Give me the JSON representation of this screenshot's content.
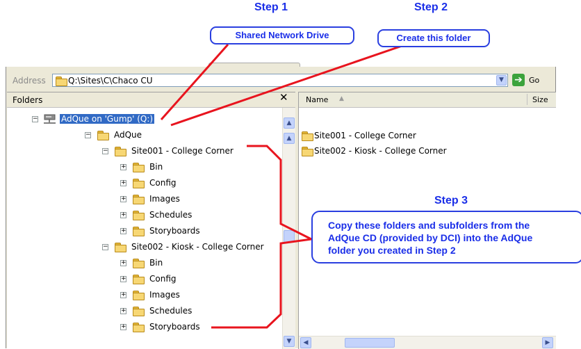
{
  "annotations": {
    "step1": {
      "title": "Step 1",
      "note": "Shared Network Drive"
    },
    "step2": {
      "title": "Step 2",
      "note": "Create this folder"
    },
    "step3": {
      "title": "Step 3",
      "note_lines": [
        "Copy these folders and subfolders from the",
        "AdQue CD (provided by DCI) into the AdQue",
        "folder you created in Step 2"
      ]
    }
  },
  "address_bar": {
    "label": "Address",
    "value": "Q:\\Sites\\C\\Chaco CU",
    "go_label": "Go"
  },
  "folders_pane": {
    "title": "Folders",
    "close_glyph": "✕",
    "tree": {
      "drive": "AdQue on 'Gump' (Q:)",
      "adque": "AdQue",
      "site1": {
        "name": "Site001 - College Corner",
        "children": [
          "Bin",
          "Config",
          "Images",
          "Schedules",
          "Storyboards"
        ]
      },
      "site2": {
        "name": "Site002 - Kiosk - College Corner",
        "children": [
          "Bin",
          "Config",
          "Images",
          "Schedules",
          "Storyboards"
        ]
      }
    }
  },
  "contents_pane": {
    "columns": {
      "name": "Name",
      "size": "Size"
    },
    "items": [
      "Site001 - College Corner",
      "Site002 - Kiosk - College Corner"
    ]
  },
  "colors": {
    "annotation_blue": "#1a2ee8",
    "arrow_red": "#e8141e",
    "selection": "#316ac5"
  }
}
